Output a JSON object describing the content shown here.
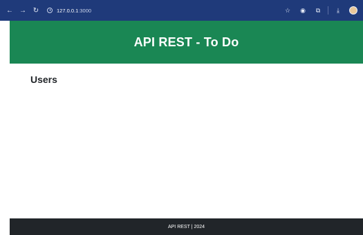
{
  "browser": {
    "url_host": "127.0.0.1",
    "url_port": ":3000",
    "icons": [
      "back-arrow-icon",
      "forward-arrow-icon",
      "reload-icon",
      "site-info-icon",
      "star-icon",
      "camera-icon",
      "extensions-icon",
      "download-icon",
      "profile-avatar-icon"
    ]
  },
  "header": {
    "title": "API REST - To Do",
    "background": "#1a8754"
  },
  "main": {
    "section_title": "Users"
  },
  "footer": {
    "text": "API REST | 2024",
    "background": "#212529"
  }
}
